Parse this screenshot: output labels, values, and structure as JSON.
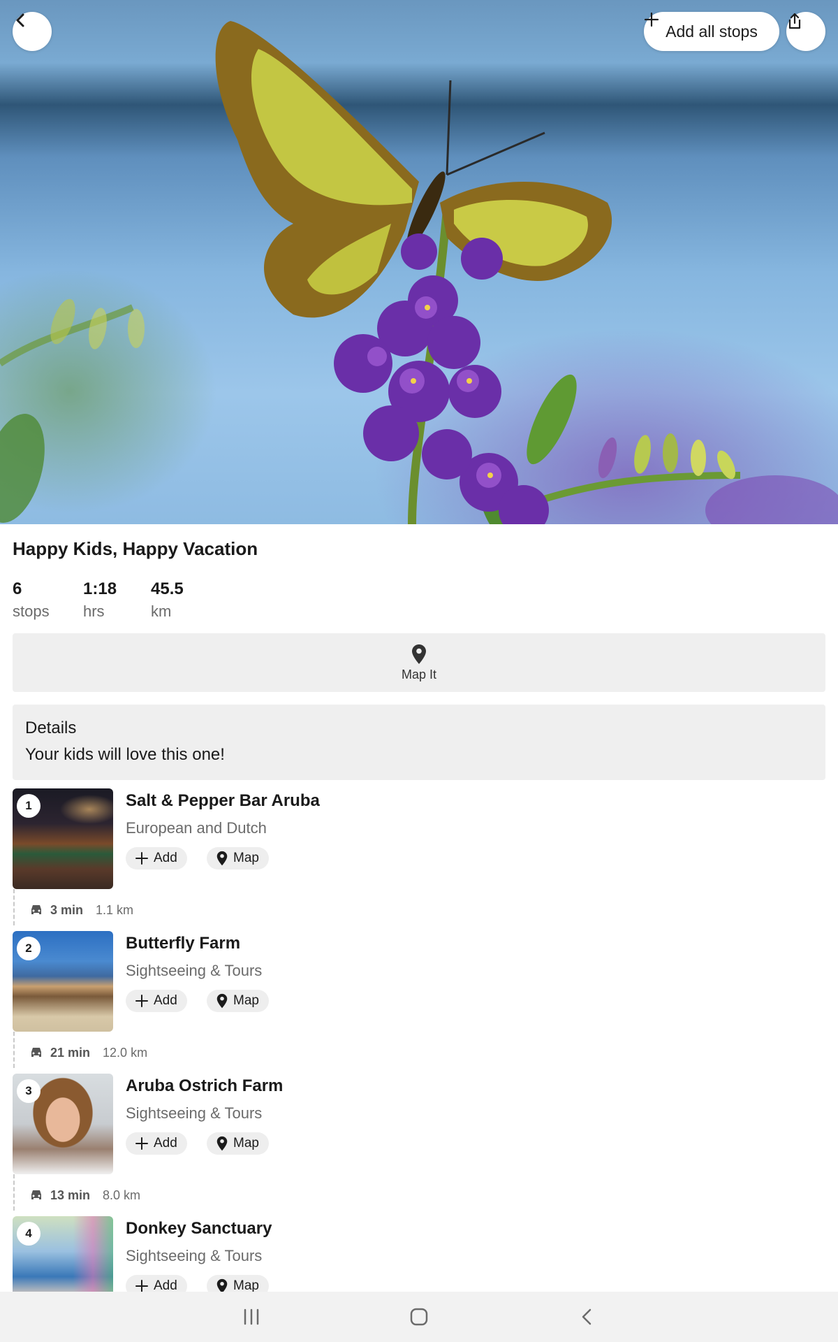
{
  "header": {
    "add_all_label": "Add all stops"
  },
  "trip": {
    "title": "Happy Kids, Happy Vacation",
    "stats": [
      {
        "value": "6",
        "unit": "stops"
      },
      {
        "value": "1:18",
        "unit": "hrs"
      },
      {
        "value": "45.5",
        "unit": "km"
      }
    ]
  },
  "map_it": {
    "label": "Map It"
  },
  "details": {
    "heading": "Details",
    "text": "Your kids will love this one!"
  },
  "stops": [
    {
      "number": "1",
      "name": "Salt & Pepper Bar Aruba",
      "category": "European and Dutch",
      "add_label": "Add",
      "map_label": "Map"
    },
    {
      "number": "2",
      "name": "Butterfly Farm",
      "category": "Sightseeing & Tours",
      "add_label": "Add",
      "map_label": "Map"
    },
    {
      "number": "3",
      "name": "Aruba Ostrich Farm",
      "category": "Sightseeing & Tours",
      "add_label": "Add",
      "map_label": "Map"
    },
    {
      "number": "4",
      "name": "Donkey Sanctuary",
      "category": "Sightseeing & Tours",
      "add_label": "Add",
      "map_label": "Map"
    }
  ],
  "legs": [
    {
      "time": "3 min",
      "distance": "1.1 km"
    },
    {
      "time": "21 min",
      "distance": "12.0 km"
    },
    {
      "time": "13 min",
      "distance": "8.0 km"
    }
  ],
  "icons": {
    "back": "chevron-left-icon",
    "add": "plus-icon",
    "share": "share-icon",
    "map_pin": "map-pin-icon",
    "car": "car-icon",
    "nav_recents": "recents-icon",
    "nav_home": "home-icon",
    "nav_back": "back-icon"
  },
  "colors": {
    "surface": "#efefef",
    "pill": "#eeeeee",
    "muted_text": "#6b6b6b",
    "navbar": "#f2f2f2"
  }
}
